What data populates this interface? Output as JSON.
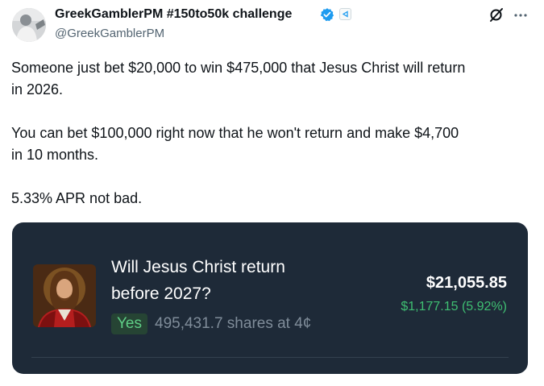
{
  "author": {
    "display_name": "GreekGamblerPM #150to50k challenge",
    "handle": "@GreekGamblerPM"
  },
  "icons": {
    "verified": "verified-badge-icon",
    "affiliate": "affiliate-badge-icon",
    "grok": "grok-icon",
    "more": "more-options-icon"
  },
  "tweet": {
    "paragraphs": [
      "Someone just bet $20,000 to win $475,000 that Jesus Christ will return",
      "in 2026.",
      "You can bet $100,000 right now that he won't return and make $4,700",
      "in 10 months.",
      "5.33% APR not bad."
    ]
  },
  "card": {
    "question_line1": "Will Jesus Christ return",
    "question_line2": "before 2027?",
    "outcome": "Yes",
    "shares_text": "495,431.7 shares at 4¢",
    "value": "$21,055.85",
    "change": "$1,177.15 (5.92%)"
  },
  "colors": {
    "verified_blue": "#1d9bf0",
    "card_background": "#1e2a38",
    "positive_green": "#3fbf72"
  }
}
